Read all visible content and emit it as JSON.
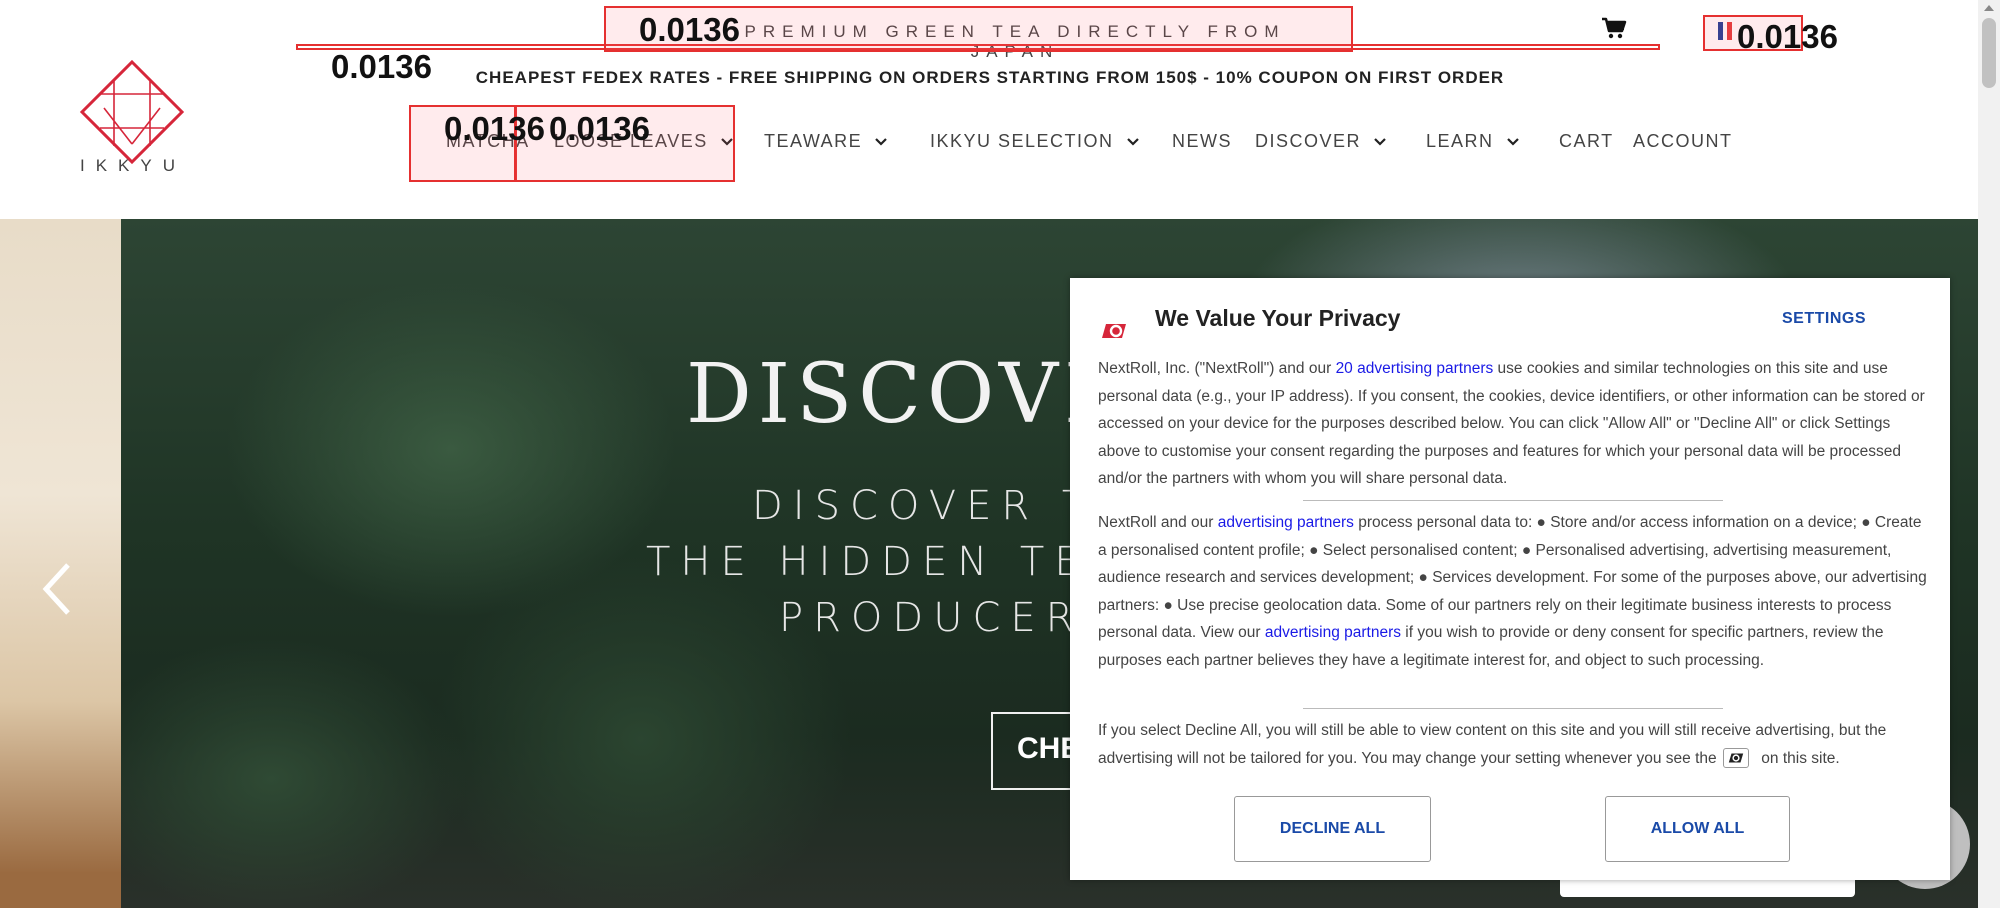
{
  "header": {
    "promo": "PREMIUM GREEN TEA DIRECTLY FROM JAPAN",
    "shipping": "CHEAPEST FEDEX RATES - FREE SHIPPING ON ORDERS STARTING FROM 150$ - 10% COUPON ON FIRST ORDER",
    "logo_text": "IKKYU",
    "cart_icon": "cart-icon",
    "flag_icon": "flag-fr-icon"
  },
  "nav": {
    "items": [
      {
        "label": "MATCHA",
        "has_dropdown": false
      },
      {
        "label": "LOOSE LEAVES",
        "has_dropdown": true
      },
      {
        "label": "TEAWARE",
        "has_dropdown": true
      },
      {
        "label": "IKKYU SELECTION",
        "has_dropdown": true
      },
      {
        "label": "NEWS",
        "has_dropdown": false
      },
      {
        "label": "DISCOVER",
        "has_dropdown": true
      },
      {
        "label": "LEARN",
        "has_dropdown": true
      },
      {
        "label": "CART",
        "has_dropdown": false
      },
      {
        "label": "ACCOUNT",
        "has_dropdown": false
      }
    ]
  },
  "annotations": {
    "labels": [
      "0.0136",
      "0.0136",
      "0.0136",
      "0.0136",
      "0.0136"
    ]
  },
  "hero": {
    "title": "DISCOVER",
    "subtitle_lines": [
      "DISCOVER T",
      "THE HIDDEN TEA",
      "PRODUCER"
    ],
    "button": "CHE",
    "prev_icon": "chevron-left-icon"
  },
  "privacy": {
    "title": "We Value Your Privacy",
    "settings": "SETTINGS",
    "p1_a": "NextRoll, Inc. (\"NextRoll\") and our ",
    "p1_link": "20 advertising partners",
    "p1_b": " use cookies and similar technologies on this site and use personal data (e.g., your IP address). If you consent, the cookies, device identifiers, or other information can be stored or accessed on your device for the purposes described below. You can click \"Allow All\" or \"Decline All\" or click Settings above to customise your consent regarding the purposes and features for which your personal data will be processed and/or the partners with whom you will share personal data.",
    "p2_a": "NextRoll and our ",
    "p2_link1": "advertising partners",
    "p2_b": " process personal data to: ● Store and/or access information on a device; ● Create a personalised content profile; ● Select personalised content; ● Personalised advertising, advertising measurement, audience research and services development; ● Services development. For some of the purposes above, our advertising partners: ● Use precise geolocation data. Some of our partners rely on their legitimate business interests to process personal data. View our ",
    "p2_link2": "advertising partners",
    "p2_c": " if you wish to provide or deny consent for specific partners, review the purposes each partner believes they have a legitimate interest for, and object to such processing.",
    "p3_a": "If you select Decline All, you will still be able to view content on this site and you will still receive advertising, but the advertising will not be tailored for you. You may change your setting whenever you see the ",
    "p3_b": " on this site.",
    "decline": "DECLINE ALL",
    "allow": "ALLOW ALL",
    "link_color": "#1a1ae6",
    "button_color": "#1a4aa8"
  }
}
